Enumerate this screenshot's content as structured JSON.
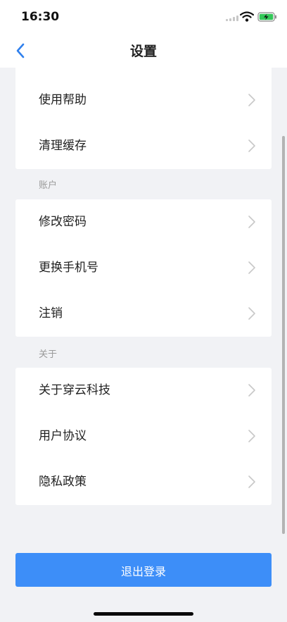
{
  "status_bar": {
    "time": "16:30"
  },
  "nav": {
    "title": "设置",
    "back_icon": "chevron-left-icon"
  },
  "sections": {
    "general": {
      "items": [
        {
          "label": "使用帮助"
        },
        {
          "label": "清理缓存"
        }
      ]
    },
    "account": {
      "title": "账户",
      "items": [
        {
          "label": "修改密码"
        },
        {
          "label": "更换手机号"
        },
        {
          "label": "注销"
        }
      ]
    },
    "about": {
      "title": "关于",
      "items": [
        {
          "label": "关于穿云科技"
        },
        {
          "label": "用户协议"
        },
        {
          "label": "隐私政策"
        }
      ]
    }
  },
  "logout": {
    "label": "退出登录"
  },
  "colors": {
    "accent": "#3d8ef8",
    "background": "#f1f2f5",
    "card": "#ffffff",
    "battery_fill": "#34c759"
  }
}
